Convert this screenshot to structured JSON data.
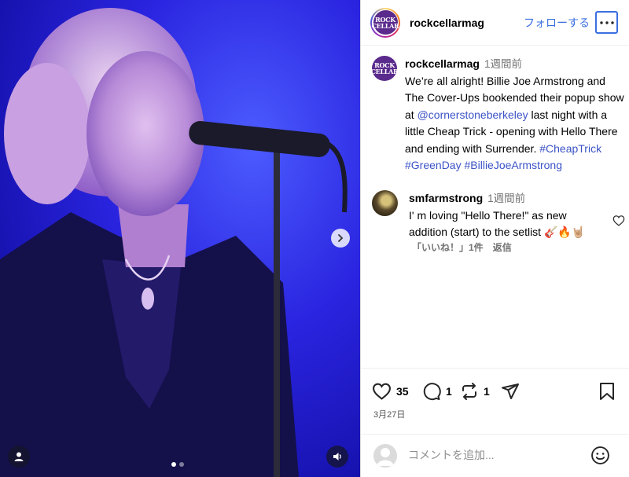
{
  "post": {
    "username": "rockcellarmag",
    "follow_label": "フォローする",
    "more_icon": "more-horizontal-icon"
  },
  "logo": {
    "line1": "ROCK",
    "line2": "CELLAR"
  },
  "caption": {
    "username": "rockcellarmag",
    "time": "1週間前",
    "text_1": "We’re all alright! Billie Joe Armstrong and The Cover-Ups bookended their popup show at ",
    "mention": "@cornerstoneberkeley",
    "text_2": " last night with a little Cheap Trick - opening with Hello There and ending with Surrender. ",
    "hashtags": [
      "#CheapTrick",
      "#GreenDay",
      "#BillieJoeArmstrong"
    ]
  },
  "comment": {
    "username": "smfarmstrong",
    "time": "1週間前",
    "text": "I' m loving \"Hello There!\" as new addition (start) to the setlist 🎸🔥🤘🏼",
    "likes_label": "「いいね！」1件",
    "reply_label": "返信"
  },
  "actions": {
    "likes": "35",
    "comments": "1",
    "reposts": "1",
    "date": "3月27日"
  },
  "add_comment": {
    "placeholder": "コメントを追加..."
  },
  "media": {
    "slide_count": 2,
    "active_slide": 1
  },
  "colors": {
    "accent": "#3b6fe0",
    "link": "#3b53c6",
    "stage_blue": "#1f1ad6"
  }
}
